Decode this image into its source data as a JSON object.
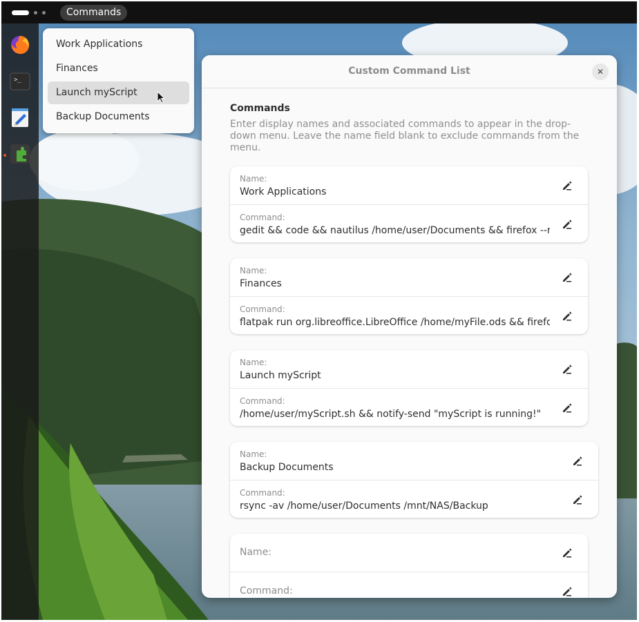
{
  "topbar": {
    "app_menu_label": "Commands"
  },
  "dock": {
    "items": [
      {
        "icon": "firefox-icon"
      },
      {
        "icon": "terminal-icon",
        "glyph": ">_"
      },
      {
        "icon": "text-editor-icon"
      },
      {
        "icon": "extensions-icon"
      }
    ]
  },
  "dropdown": {
    "items": [
      {
        "label": "Work Applications"
      },
      {
        "label": "Finances"
      },
      {
        "label": "Launch myScript"
      },
      {
        "label": "Backup Documents"
      }
    ]
  },
  "dialog": {
    "title": "Custom Command List",
    "close_glyph": "✕",
    "section_title": "Commands",
    "section_description": "Enter display names and associated commands to appear in the drop-down menu. Leave the name field blank to exclude commands from the menu.",
    "name_label": "Name:",
    "command_label": "Command:",
    "entries": [
      {
        "name": "Work Applications",
        "command": "gedit && code && nautilus /home/user/Documents && firefox --new-tab"
      },
      {
        "name": "Finances",
        "command": "flatpak run org.libreoffice.LibreOffice /home/myFile.ods && firefox --new-tab"
      },
      {
        "name": "Launch myScript",
        "command": "/home/user/myScript.sh  && notify-send \"myScript is running!\""
      },
      {
        "name": "Backup Documents",
        "command": "rsync -av /home/user/Documents /mnt/NAS/Backup"
      },
      {
        "name": "",
        "command": ""
      }
    ]
  },
  "colors": {
    "topbar": "#111111",
    "accent": "#e95420",
    "dialog_bg": "#fafafa",
    "card_bg": "#ffffff"
  }
}
